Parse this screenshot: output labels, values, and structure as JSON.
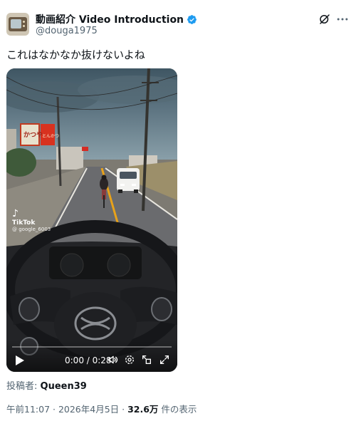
{
  "author": {
    "display_name": "動画紹介 Video Introduction",
    "handle": "@douga1975",
    "avatar_icon": "retro-tv-icon",
    "verified_icon": "verified-badge-icon",
    "verified_color": "#1d9bf0"
  },
  "header_actions": {
    "grok_icon": "grok-icon",
    "more_icon": "more-options-icon"
  },
  "tweet": {
    "text": "これはなかなか抜けないよね"
  },
  "video": {
    "watermark_brand": "TikTok",
    "watermark_user": "@ google_6003",
    "scene_signs": [
      "かつや",
      "とんかつ"
    ],
    "time_display": "0:00 / 0:28",
    "progress": 0,
    "controls": [
      "play-icon",
      "volume-icon",
      "settings-icon",
      "pip-icon",
      "fullscreen-icon"
    ]
  },
  "poster": {
    "label": "投稿者: ",
    "name": "Queen39"
  },
  "meta": {
    "time": "午前11:07",
    "sep1": " · ",
    "date": "2026年4月5日",
    "sep2": " · ",
    "views": "32.6万",
    "views_label": " 件の表示"
  },
  "colors": {
    "text_primary": "#0f1419",
    "text_secondary": "#536471",
    "accent": "#1d9bf0"
  }
}
